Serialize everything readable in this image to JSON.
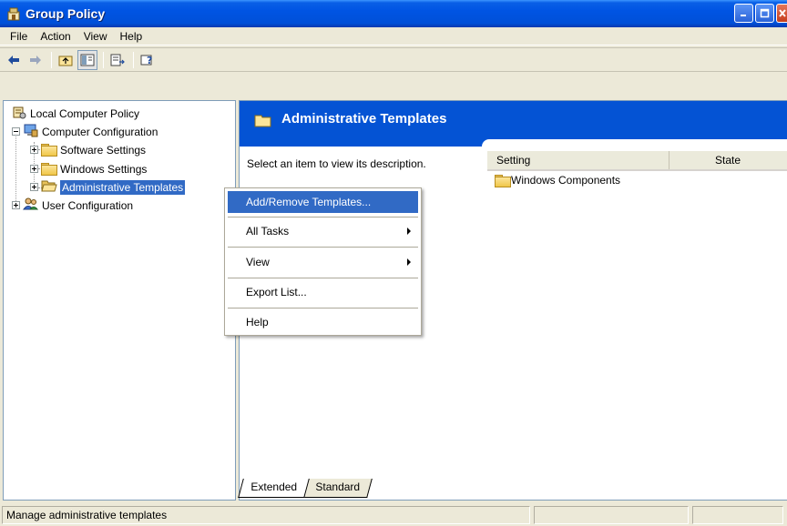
{
  "window": {
    "title": "Group Policy"
  },
  "menubar": {
    "items": [
      "File",
      "Action",
      "View",
      "Help"
    ]
  },
  "toolbar": {
    "icons": [
      "back-arrow-icon",
      "forward-arrow-icon",
      "up-folder-icon",
      "show-hide-tree-icon",
      "export-list-icon",
      "help-icon"
    ]
  },
  "tree": {
    "root": "Local Computer Policy",
    "computer": "Computer Configuration",
    "software": "Software Settings",
    "windows": "Windows Settings",
    "admin": "Administrative Templates",
    "user": "User Configuration"
  },
  "right": {
    "heading": "Administrative Templates",
    "description": "Select an item to view its description.",
    "columns": {
      "setting": "Setting",
      "state": "State"
    },
    "rows": [
      "Windows Components"
    ]
  },
  "tabs": [
    "Extended",
    "Standard"
  ],
  "context_menu": {
    "add_remove": "Add/Remove Templates...",
    "all_tasks": "All Tasks",
    "view": "View",
    "export": "Export List...",
    "help": "Help"
  },
  "status": {
    "text": "Manage administrative templates"
  },
  "colors": {
    "titlebar": "#0054e3",
    "selection": "#316ac5",
    "banner": "#0453d4"
  }
}
